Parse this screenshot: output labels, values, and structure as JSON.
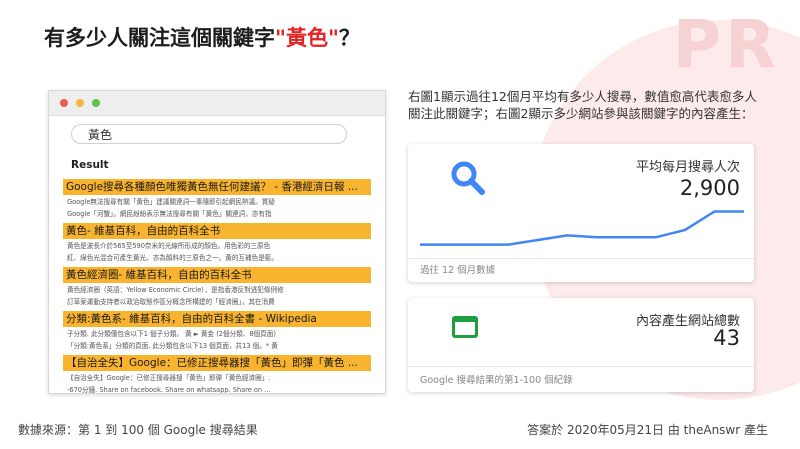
{
  "headline": {
    "prefix": "有多少人關注這個關鍵字",
    "keyword": "\"黃色\"",
    "suffix": "？"
  },
  "browser": {
    "search_value": "黃色",
    "result_heading": "Result",
    "results": [
      {
        "title": "Google搜尋各種顏色唯獨黃色無任何建議？ - 香港經濟日報 ...",
        "lines": [
          "Google無法搜尋有關「黃色」建議關連詞一事隨即引起網民熱議。質疑",
          "Google「河蟹」。網民紛紛表示無法搜尋有關「黃色」關連詞，亦有指"
        ]
      },
      {
        "title": "黃色- 維基百科，自由的百科全书",
        "lines": [
          "黃色是波長介於565至590奈米的光線所形成的顏色。用色彩的三原色",
          "紅、綠色光混合可產生黃光。亦為顏料的三原色之一。黃的互補色是藍。"
        ]
      },
      {
        "title": "黃色經濟圈- 維基百科，自由的百科全书",
        "lines": [
          "黃色經濟圈（英語：Yellow Economic Circle），是指香港反對逃犯條例修",
          "訂草案運動支持者以政治取態作區分概念所構建的「經濟圈」，其在消費"
        ]
      },
      {
        "title": "分類:黃色系- 維基百科，自由的百科全書 - Wikipedia",
        "lines": [
          "子分類. 此分類僅包含以下1 個子分類。 黃 ► 黃金 (2個分類、8個頁面)",
          "「分類:黃色系」分類的頁面. 此分類包含以下13 個頁面，共13 個。* 黃"
        ]
      },
      {
        "title": "【自治全失】Google：已修正搜尋器搜「黃色」即彈「黃色 ...",
        "lines": [
          "【自治全失】Google：已修正搜尋器搜「黃色」即彈「黃色經濟圈」.",
          "-670分鐘. Share on facebook. Share on whatsapp. Share on ..."
        ]
      }
    ]
  },
  "intro": "右圖1顯示過往12個月平均有多少人搜尋，數值愈高代表愈多人關注此關鍵字；右圖2顯示多少網站參與該關鍵字的內容產生：",
  "card1": {
    "label": "平均每月搜尋人次",
    "value": "2,900",
    "foot": "過往 12 個月數據",
    "icon": "search-icon"
  },
  "card2": {
    "label": "內容產生網站總數",
    "value": "43",
    "foot": "Google 搜尋結果的第1-100 個紀錄",
    "icon": "website-icon"
  },
  "chart_data": {
    "type": "line",
    "title": "",
    "xlabel": "",
    "ylabel": "",
    "x": [
      1,
      2,
      3,
      4,
      5,
      6,
      7,
      8,
      9,
      10,
      11,
      12
    ],
    "series": [
      {
        "values": [
          1900,
          1900,
          1900,
          1900,
          2150,
          2400,
          2300,
          2300,
          2300,
          2700,
          3700,
          3700
        ]
      }
    ],
    "ylim": [
      1500,
      4000
    ],
    "grid": false,
    "color": "#4285f4"
  },
  "footer": {
    "source": "數據來源：第 1 到 100 個 Google 搜尋結果",
    "credit_prefix": "答案於 2020年05月21日 由 theAnswr 產生"
  },
  "colors": {
    "highlight": "#f8b32f",
    "keyword": "#e52222",
    "accent": "#4285f4",
    "site_icon": "#1e9e3e"
  }
}
